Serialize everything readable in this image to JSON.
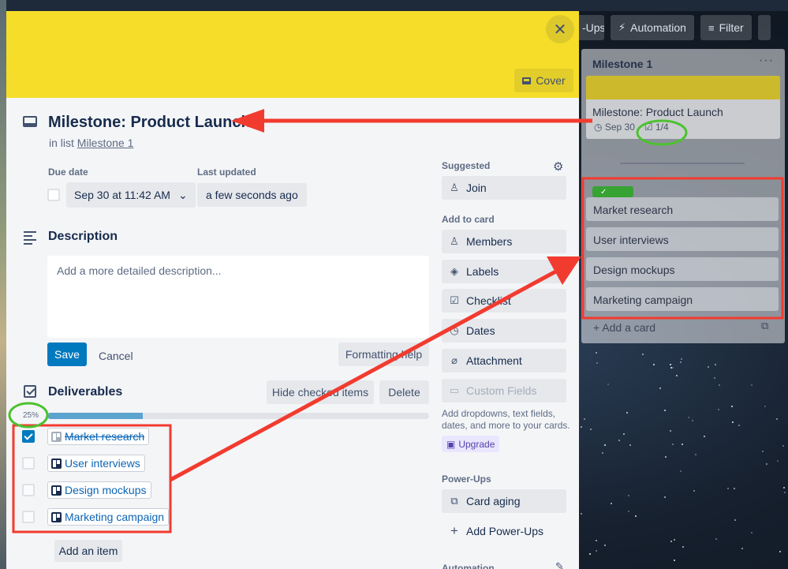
{
  "board": {
    "header_buttons": [
      {
        "label": "-Ups",
        "icon": "power-ups-icon"
      },
      {
        "label": "Automation",
        "icon": "bolt-icon"
      },
      {
        "label": "Filter",
        "icon": "filter-icon"
      }
    ],
    "list": {
      "title": "Milestone 1",
      "menu": "···",
      "card_title": "Milestone: Product Launch",
      "card_due": "Sep 30",
      "card_checklist": "1/4",
      "mini_cards": [
        "Market research",
        "User interviews",
        "Design mockups",
        "Marketing campaign"
      ],
      "add_card": "+ Add a card"
    }
  },
  "modal": {
    "cover_button": "Cover",
    "title": "Milestone: Product Launch",
    "in_list_prefix": "in list ",
    "in_list_name": "Milestone 1",
    "due_date_label": "Due date",
    "due_date_value": "Sep 30 at 11:42 AM",
    "last_updated_label": "Last updated",
    "last_updated_value": "a few seconds ago",
    "description_title": "Description",
    "description_placeholder": "Add a more detailed description...",
    "save": "Save",
    "cancel": "Cancel",
    "formatting_help": "Formatting help",
    "checklist": {
      "title": "Deliverables",
      "hide_checked": "Hide checked items",
      "delete": "Delete",
      "progress_label": "25%",
      "progress": 0.25,
      "items": [
        {
          "label": "Market research",
          "done": true
        },
        {
          "label": "User interviews",
          "done": false
        },
        {
          "label": "Design mockups",
          "done": false
        },
        {
          "label": "Marketing campaign",
          "done": false
        }
      ],
      "add_item": "Add an item"
    }
  },
  "sidebar": {
    "suggested": "Suggested",
    "join": "Join",
    "add_to_card": "Add to card",
    "members": "Members",
    "labels": "Labels",
    "checklist": "Checklist",
    "dates": "Dates",
    "attachment": "Attachment",
    "custom_fields": "Custom Fields",
    "custom_fields_note": "Add dropdowns, text fields, dates, and more to your cards.",
    "upgrade": "Upgrade",
    "power_ups": "Power-Ups",
    "card_aging": "Card aging",
    "add_power_ups": "Add Power-Ups",
    "automation": "Automation"
  },
  "colors": {
    "cover": "#f5dd29",
    "accent_blue": "#0079bf",
    "annotation_red": "#f23b2f",
    "annotation_green": "#4cc230"
  }
}
